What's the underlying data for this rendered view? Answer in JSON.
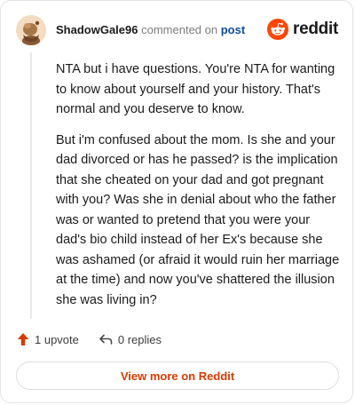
{
  "comment": {
    "username": "ShadowGale96",
    "action_text": "commented on",
    "post_link": "post",
    "paragraphs": [
      "NTA but i have questions. You're NTA for wanting to know about yourself and your history. That's normal and you deserve to know.",
      "But i'm confused about the mom. Is she and your dad divorced or has he passed? is the implication that she cheated on your dad and got pregnant with you? Was she in denial about who the father was or wanted to pretend that you were your dad's bio child instead of her Ex's because she was ashamed (or afraid it would ruin her marriage at the time) and now you've shattered the illusion she was living in?"
    ]
  },
  "brand": {
    "name": "reddit",
    "color": "#ff4500"
  },
  "actions": {
    "upvotes": "1 upvote",
    "replies": "0 replies",
    "upvote_icon": "upvote-arrow-icon",
    "reply_icon": "reply-arrow-icon"
  },
  "footer": {
    "view_more": "View more on Reddit",
    "accent_color": "#d93a00"
  }
}
